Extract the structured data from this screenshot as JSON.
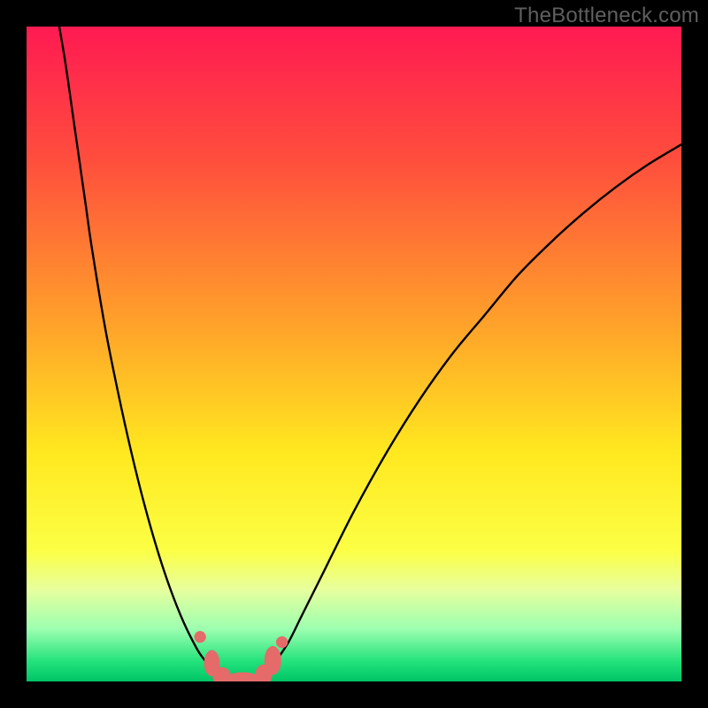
{
  "watermark": "TheBottleneck.com",
  "chart_data": {
    "type": "line",
    "title": "",
    "xlabel": "",
    "ylabel": "",
    "xlim": [
      0,
      100
    ],
    "ylim": [
      0,
      100
    ],
    "grid": false,
    "legend": false,
    "background_gradient": [
      {
        "pos": 0.0,
        "color": "#ff1a52"
      },
      {
        "pos": 0.2,
        "color": "#ff4d3d"
      },
      {
        "pos": 0.45,
        "color": "#ffa02a"
      },
      {
        "pos": 0.65,
        "color": "#ffe81f"
      },
      {
        "pos": 0.8,
        "color": "#fcff45"
      },
      {
        "pos": 0.86,
        "color": "#e7ff9e"
      },
      {
        "pos": 0.92,
        "color": "#9cffb0"
      },
      {
        "pos": 0.97,
        "color": "#22e27b"
      },
      {
        "pos": 1.0,
        "color": "#00c466"
      }
    ],
    "series": [
      {
        "name": "left-curve",
        "color": "#000000",
        "x": [
          5,
          6,
          7,
          8,
          9,
          10,
          12,
          14,
          16,
          18,
          20,
          22,
          24,
          26,
          27,
          28,
          29,
          30,
          31
        ],
        "y": [
          100,
          94,
          87,
          80,
          73,
          66,
          54,
          44,
          35,
          27,
          20,
          14,
          9,
          5,
          3.5,
          2.2,
          1.2,
          0.5,
          0.1
        ]
      },
      {
        "name": "right-curve",
        "color": "#000000",
        "x": [
          35,
          36,
          37,
          38,
          40,
          42,
          45,
          50,
          55,
          60,
          65,
          70,
          75,
          80,
          85,
          90,
          95,
          100
        ],
        "y": [
          0.1,
          0.5,
          1.5,
          3,
          6,
          10,
          16,
          26,
          35,
          43,
          50,
          56,
          62,
          67,
          71.5,
          75.5,
          79,
          82
        ]
      },
      {
        "name": "floor",
        "color": "#000000",
        "x": [
          31,
          35
        ],
        "y": [
          0.1,
          0.1
        ]
      }
    ],
    "markers": [
      {
        "name": "dot-left-upper",
        "x": 26.5,
        "y": 6.8,
        "r": 0.9,
        "color": "#e56a6a"
      },
      {
        "name": "blob-left-1",
        "x": 28.3,
        "y": 2.8,
        "rx": 1.2,
        "ry": 2.0,
        "color": "#e56a6a"
      },
      {
        "name": "blob-left-2",
        "x": 29.8,
        "y": 0.8,
        "rx": 1.4,
        "ry": 1.4,
        "color": "#e56a6a"
      },
      {
        "name": "blob-bottom",
        "x": 33.0,
        "y": 0.2,
        "rx": 3.0,
        "ry": 1.2,
        "color": "#e56a6a"
      },
      {
        "name": "blob-right-1",
        "x": 36.2,
        "y": 1.0,
        "rx": 1.3,
        "ry": 1.6,
        "color": "#e56a6a"
      },
      {
        "name": "blob-right-2",
        "x": 37.6,
        "y": 3.2,
        "rx": 1.3,
        "ry": 2.2,
        "color": "#e56a6a"
      },
      {
        "name": "dot-right-upper",
        "x": 39.0,
        "y": 6.0,
        "r": 0.9,
        "color": "#e56a6a"
      }
    ]
  }
}
